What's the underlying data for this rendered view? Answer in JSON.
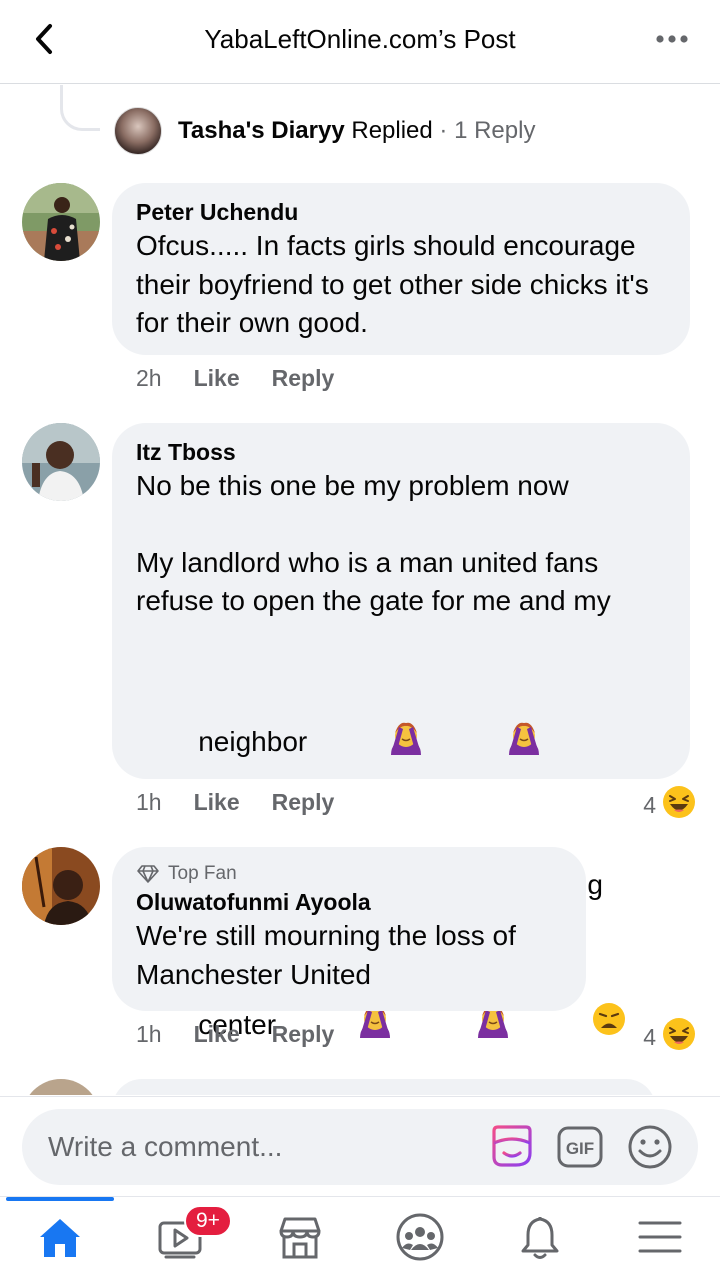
{
  "header": {
    "title": "YabaLeftOnline.com’s Post"
  },
  "replied": {
    "name": "Tasha's Diaryy",
    "verb": "Replied",
    "count": "· 1 Reply"
  },
  "comments": [
    {
      "author": "Peter Uchendu",
      "body": "Ofcus..... In facts girls should encourage their boyfriend to get other side chicks it's for their own good.",
      "time": "2h",
      "like": "Like",
      "reply": "Reply"
    },
    {
      "author": "Itz Tboss",
      "line1": "No be this one be my problem now",
      "line2": "My landlord who is a man united fans refuse to open the gate for me and my",
      "line3": "neighbor",
      "line4": "He said we should go back to viewing",
      "line5": "center",
      "time": "1h",
      "like": "Like",
      "reply": "Reply",
      "reaction_count": "4",
      "reaction_icon": "laughing-emoji"
    },
    {
      "badge": "Top Fan",
      "author": "Oluwatofunmi Ayoola",
      "body": "We're still mourning the loss of Manchester United",
      "time": "1h",
      "like": "Like",
      "reply": "Reply",
      "reaction_count": "4",
      "reaction_icon": "laughing-emoji"
    }
  ],
  "composer": {
    "placeholder": "Write a comment...",
    "gif_label": "GIF"
  },
  "tabbar": {
    "video_badge": "9+"
  },
  "colors": {
    "accent": "#1877f2",
    "bubble": "#f0f2f5",
    "secondary_text": "#65676b",
    "badge": "#e41e3f"
  }
}
